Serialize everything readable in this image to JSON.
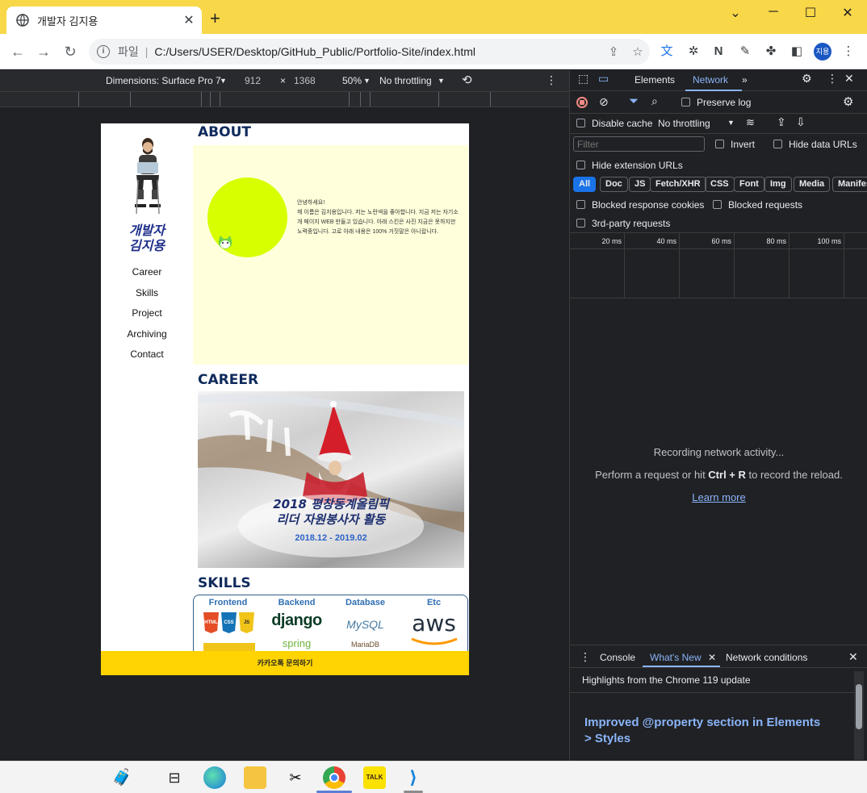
{
  "browser": {
    "tab_title": "개발자 김지용",
    "tab_close": "✕",
    "new_tab": "+",
    "window_minimize": "─",
    "window_maximize": "☐",
    "window_close": "✕",
    "window_restore": "⌄",
    "address_scheme": "파일",
    "address_url": "C:/Users/USER/Desktop/GitHub_Public/Portfolio-Site/index.html",
    "profile": "지용"
  },
  "device_toolbar": {
    "dimensions": "Dimensions: Surface Pro 7",
    "width": "912",
    "times": "×",
    "height": "1368",
    "zoom": "50%",
    "throttling": "No throttling"
  },
  "page": {
    "name": "개발자\n김지용",
    "nav": [
      "Career",
      "Skills",
      "Project",
      "Archiving",
      "Contact"
    ],
    "about_title": "ABOUT",
    "about_text": "안녕하세요!\n제 이름은 김지용입니다. 저는 노란색을 좋아합니다. 지금 저는 자기소개 페이지 WEB 만들고 있습니다. 아래 스킨은 사진 지금은 못하지만 노력중입니다. 고로 아래 내용은 100% 거짓말은 아니랍니다.",
    "career_title": "CAREER",
    "career_item_title": "2018 평창동계올림픽\n리더 자원봉사자 활동",
    "career_item_date": "2018.12 - 2019.02",
    "skills_title": "SKILLS",
    "skills_headers": [
      "Frontend",
      "Backend",
      "Database",
      "Etc"
    ],
    "skills_logos": {
      "backend_1": "django",
      "backend_2": "spring",
      "db_1": "MySQL",
      "db_2": "MariaDB",
      "etc_1": "aws",
      "frontend_badges": [
        "HTML",
        "CSS",
        "JS"
      ]
    },
    "kakao_button": "카카오톡 문의하기"
  },
  "devtools": {
    "tabs": [
      "Elements",
      "Network"
    ],
    "active_tab": "Network",
    "preserve_log": "Preserve log",
    "disable_cache": "Disable cache",
    "throttling": "No throttling",
    "filter_placeholder": "Filter",
    "invert": "Invert",
    "hide_data_urls": "Hide data URLs",
    "hide_extension_urls": "Hide extension URLs",
    "filter_chips": [
      "All",
      "Doc",
      "JS",
      "Fetch/XHR",
      "CSS",
      "Font",
      "Img",
      "Media",
      "Manifes"
    ],
    "blocked_response_cookies": "Blocked response cookies",
    "blocked_requests": "Blocked requests",
    "third_party": "3rd-party requests",
    "timeline_labels": [
      "20 ms",
      "40 ms",
      "60 ms",
      "80 ms",
      "100 ms"
    ],
    "empty_line1": "Recording network activity...",
    "empty_line2_pre": "Perform a request or hit ",
    "empty_line2_key": "Ctrl + R",
    "empty_line2_post": " to record the reload.",
    "learn_more": "Learn more",
    "drawer_tabs": [
      "Console",
      "What's New",
      "Network conditions"
    ],
    "drawer_active": "What's New",
    "highlight": "Highlights from the Chrome 119 update",
    "feature_title": "Improved @property section in Elements > Styles"
  },
  "colors": {
    "chrome_tab_strip": "#f8d748",
    "page_accent_yellow": "#ffd400",
    "about_bg": "#ffffdc",
    "devtools_bg": "#202124",
    "link_blue": "#8ab4f8"
  }
}
